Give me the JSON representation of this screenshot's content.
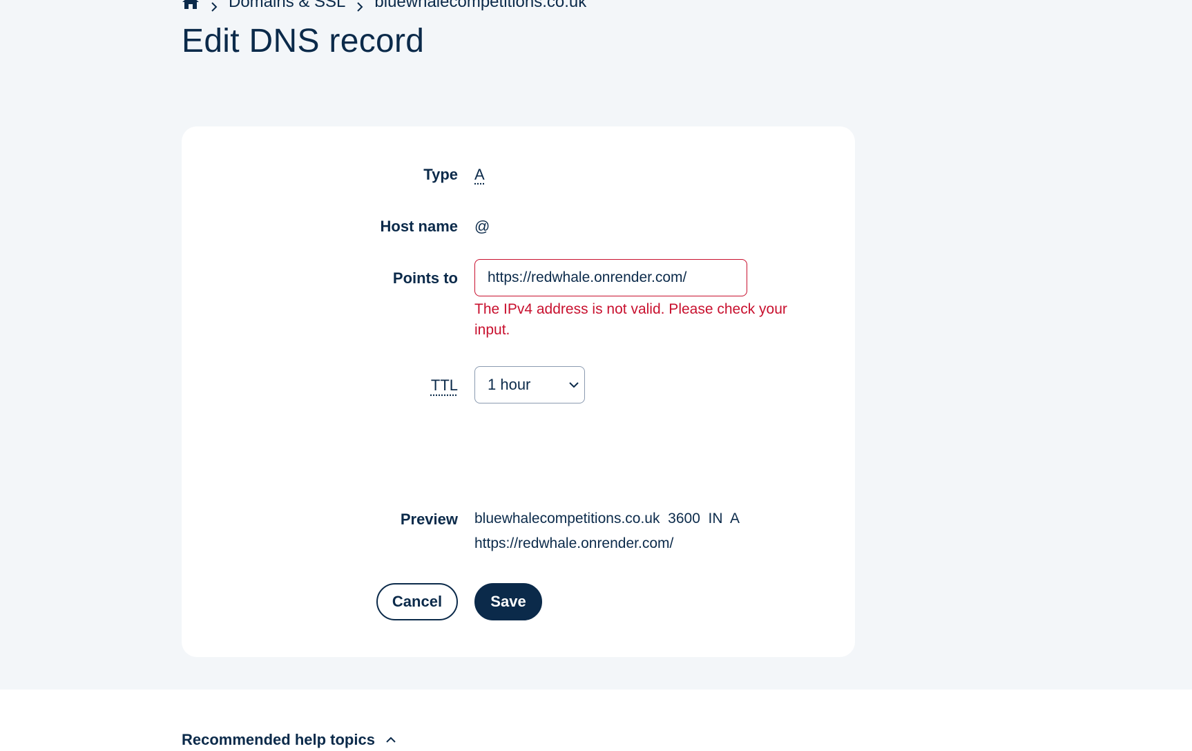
{
  "breadcrumb": {
    "home_icon": "home-icon",
    "items": [
      "Domains & SSL",
      "bluewhalecompetitions.co.uk"
    ]
  },
  "page": {
    "title": "Edit DNS record"
  },
  "form": {
    "type_label": "Type",
    "type_value": "A",
    "host_label": "Host name",
    "host_value": "@",
    "points_label": "Points to",
    "points_value": "https://redwhale.onrender.com/",
    "error": "The IPv4 address is not valid. Please check your input.",
    "ttl_label": "TTL",
    "ttl_value": "1 hour",
    "preview_label": "Preview",
    "preview_line1": "bluewhalecompetitions.co.uk  3600  IN  A",
    "preview_line2": "https://redwhale.onrender.com/",
    "cancel_label": "Cancel",
    "save_label": "Save"
  },
  "help": {
    "label": "Recommended help topics"
  },
  "colors": {
    "navy": "#0b2a4a",
    "error": "#c8102e",
    "page_bg": "#f3f6f9",
    "card_bg": "#ffffff"
  }
}
